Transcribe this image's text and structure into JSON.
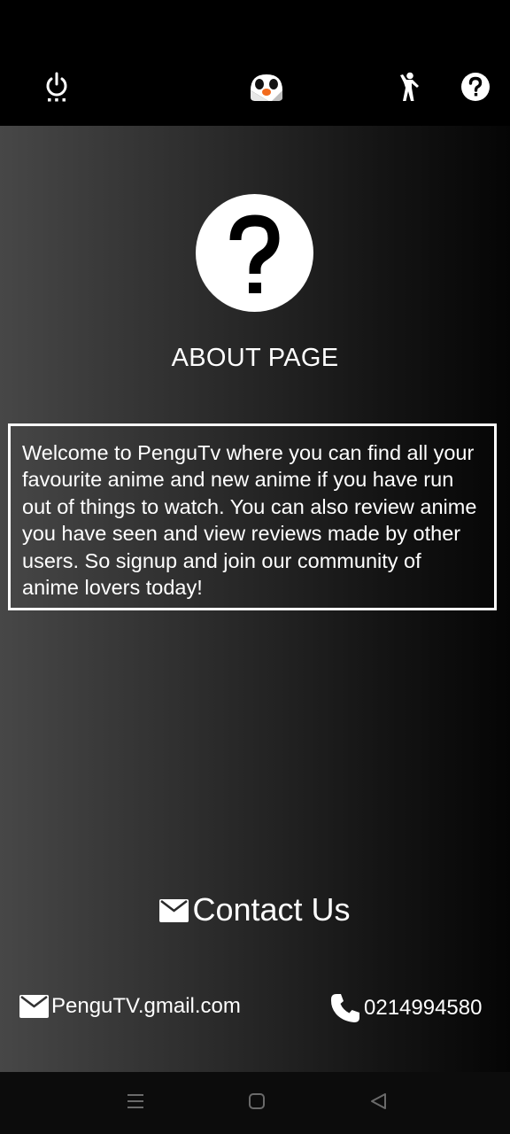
{
  "toolbar": {
    "icons": [
      "power-icon",
      "penguin-logo-icon",
      "person-standing-icon",
      "help-circle-icon"
    ]
  },
  "about": {
    "icon": "question-mark-icon",
    "title": "ABOUT PAGE",
    "description": "Welcome to PenguTv where you can find all your favourite anime and new anime if you have run out of things to watch. You can also review anime you have seen and view reviews made by other users. So signup and join our community of anime lovers today!"
  },
  "contact": {
    "title": "Contact Us",
    "email": "PenguTV.gmail.com",
    "phone": "0214994580"
  },
  "nav": {
    "icons": [
      "menu-icon",
      "home-square-icon",
      "back-triangle-icon"
    ]
  },
  "colors": {
    "toolbar_bg": "#000000",
    "content_gradient_start": "#474747",
    "content_gradient_end": "#050505",
    "text": "#ffffff",
    "penguin_beak": "#f26b1d"
  }
}
